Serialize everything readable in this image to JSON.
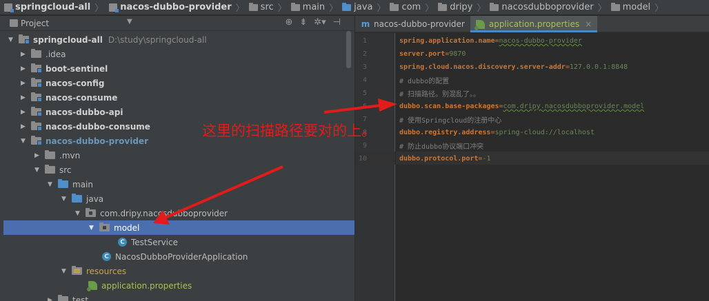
{
  "breadcrumb": {
    "items": [
      "springcloud-all",
      "nacos-dubbo-provider",
      "src",
      "main",
      "java",
      "com",
      "dripy",
      "nacosdubboprovider",
      "model"
    ]
  },
  "project_panel": {
    "title": "Project",
    "tree": [
      {
        "label": "springcloud-all",
        "hint": "D:\\study\\springcloud-all",
        "icon": "module-folder-icon",
        "expanded": true
      },
      {
        "label": ".idea",
        "icon": "folder-icon",
        "expanded": false
      },
      {
        "label": "boot-sentinel",
        "icon": "module-folder-icon",
        "expanded": false
      },
      {
        "label": "nacos-config",
        "icon": "module-folder-icon",
        "expanded": false
      },
      {
        "label": "nacos-consume",
        "icon": "module-folder-icon",
        "expanded": false
      },
      {
        "label": "nacos-dubbo-api",
        "icon": "module-folder-icon",
        "expanded": false
      },
      {
        "label": "nacos-dubbo-consume",
        "icon": "module-folder-icon",
        "expanded": false
      },
      {
        "label": "nacos-dubbo-provider",
        "icon": "module-folder-icon",
        "expanded": true
      },
      {
        "label": ".mvn",
        "icon": "folder-icon",
        "expanded": false
      },
      {
        "label": "src",
        "icon": "folder-icon",
        "expanded": true
      },
      {
        "label": "main",
        "icon": "source-folder-icon",
        "expanded": true
      },
      {
        "label": "java",
        "icon": "source-folder-icon",
        "expanded": true
      },
      {
        "label": "com.dripy.nacosdubboprovider",
        "icon": "package-icon",
        "expanded": true
      },
      {
        "label": "model",
        "icon": "package-icon",
        "expanded": true,
        "selected": true
      },
      {
        "label": "TestService",
        "icon": "class-icon"
      },
      {
        "label": "NacosDubboProviderApplication",
        "icon": "spring-class-icon"
      },
      {
        "label": "resources",
        "icon": "resources-folder-icon",
        "expanded": true
      },
      {
        "label": "application.properties",
        "icon": "spring-leaf-icon"
      },
      {
        "label": "test",
        "icon": "folder-icon",
        "expanded": false
      }
    ]
  },
  "tabs": [
    {
      "label": "nacos-dubbo-provider",
      "icon": "m-icon",
      "active": false
    },
    {
      "label": "application.properties",
      "icon": "spring-leaf-icon",
      "active": true,
      "close": "×"
    }
  ],
  "editor": {
    "lines": [
      {
        "num": "1",
        "key": "spring.application.name",
        "val": "nacos-dubbo-provider"
      },
      {
        "num": "2",
        "key": "server.port",
        "val": "9870"
      },
      {
        "num": "3",
        "key": "spring.cloud.nacos.discovery.server-addr",
        "val": "127.0.0.1:8848"
      },
      {
        "num": "4",
        "comment": "# dubbo的配置"
      },
      {
        "num": "5",
        "comment": "# 扫描路径。别混乱了。。"
      },
      {
        "num": "6",
        "key": "dubbo.scan.base-packages",
        "val": "com.dripy.nacosdubboprovider.model"
      },
      {
        "num": "7",
        "comment": "# 使用Springcloud的注册中心"
      },
      {
        "num": "8",
        "key": "dubbo.registry.address",
        "val": "spring-cloud://localhost"
      },
      {
        "num": "9",
        "comment": "# 防止dubbo协议端口冲突"
      },
      {
        "num": "10",
        "key": "dubbo.protocol.port",
        "val": "-1"
      }
    ]
  },
  "annotation": {
    "text": "这里的扫描路径要对的上。",
    "color": "#e21b1b"
  },
  "colors": {
    "selection": "#4b6eaf",
    "property_key": "#cc7832",
    "property_value": "#6a8759",
    "comment": "#808080"
  }
}
